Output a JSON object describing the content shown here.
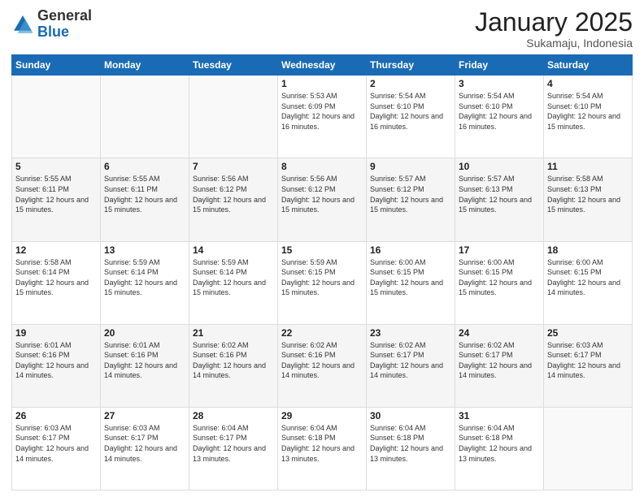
{
  "header": {
    "logo_general": "General",
    "logo_blue": "Blue",
    "month_title": "January 2025",
    "location": "Sukamaju, Indonesia"
  },
  "days_of_week": [
    "Sunday",
    "Monday",
    "Tuesday",
    "Wednesday",
    "Thursday",
    "Friday",
    "Saturday"
  ],
  "weeks": [
    [
      {
        "day": "",
        "info": ""
      },
      {
        "day": "",
        "info": ""
      },
      {
        "day": "",
        "info": ""
      },
      {
        "day": "1",
        "info": "Sunrise: 5:53 AM\nSunset: 6:09 PM\nDaylight: 12 hours and 16 minutes."
      },
      {
        "day": "2",
        "info": "Sunrise: 5:54 AM\nSunset: 6:10 PM\nDaylight: 12 hours and 16 minutes."
      },
      {
        "day": "3",
        "info": "Sunrise: 5:54 AM\nSunset: 6:10 PM\nDaylight: 12 hours and 16 minutes."
      },
      {
        "day": "4",
        "info": "Sunrise: 5:54 AM\nSunset: 6:10 PM\nDaylight: 12 hours and 15 minutes."
      }
    ],
    [
      {
        "day": "5",
        "info": "Sunrise: 5:55 AM\nSunset: 6:11 PM\nDaylight: 12 hours and 15 minutes."
      },
      {
        "day": "6",
        "info": "Sunrise: 5:55 AM\nSunset: 6:11 PM\nDaylight: 12 hours and 15 minutes."
      },
      {
        "day": "7",
        "info": "Sunrise: 5:56 AM\nSunset: 6:12 PM\nDaylight: 12 hours and 15 minutes."
      },
      {
        "day": "8",
        "info": "Sunrise: 5:56 AM\nSunset: 6:12 PM\nDaylight: 12 hours and 15 minutes."
      },
      {
        "day": "9",
        "info": "Sunrise: 5:57 AM\nSunset: 6:12 PM\nDaylight: 12 hours and 15 minutes."
      },
      {
        "day": "10",
        "info": "Sunrise: 5:57 AM\nSunset: 6:13 PM\nDaylight: 12 hours and 15 minutes."
      },
      {
        "day": "11",
        "info": "Sunrise: 5:58 AM\nSunset: 6:13 PM\nDaylight: 12 hours and 15 minutes."
      }
    ],
    [
      {
        "day": "12",
        "info": "Sunrise: 5:58 AM\nSunset: 6:14 PM\nDaylight: 12 hours and 15 minutes."
      },
      {
        "day": "13",
        "info": "Sunrise: 5:59 AM\nSunset: 6:14 PM\nDaylight: 12 hours and 15 minutes."
      },
      {
        "day": "14",
        "info": "Sunrise: 5:59 AM\nSunset: 6:14 PM\nDaylight: 12 hours and 15 minutes."
      },
      {
        "day": "15",
        "info": "Sunrise: 5:59 AM\nSunset: 6:15 PM\nDaylight: 12 hours and 15 minutes."
      },
      {
        "day": "16",
        "info": "Sunrise: 6:00 AM\nSunset: 6:15 PM\nDaylight: 12 hours and 15 minutes."
      },
      {
        "day": "17",
        "info": "Sunrise: 6:00 AM\nSunset: 6:15 PM\nDaylight: 12 hours and 15 minutes."
      },
      {
        "day": "18",
        "info": "Sunrise: 6:00 AM\nSunset: 6:15 PM\nDaylight: 12 hours and 14 minutes."
      }
    ],
    [
      {
        "day": "19",
        "info": "Sunrise: 6:01 AM\nSunset: 6:16 PM\nDaylight: 12 hours and 14 minutes."
      },
      {
        "day": "20",
        "info": "Sunrise: 6:01 AM\nSunset: 6:16 PM\nDaylight: 12 hours and 14 minutes."
      },
      {
        "day": "21",
        "info": "Sunrise: 6:02 AM\nSunset: 6:16 PM\nDaylight: 12 hours and 14 minutes."
      },
      {
        "day": "22",
        "info": "Sunrise: 6:02 AM\nSunset: 6:16 PM\nDaylight: 12 hours and 14 minutes."
      },
      {
        "day": "23",
        "info": "Sunrise: 6:02 AM\nSunset: 6:17 PM\nDaylight: 12 hours and 14 minutes."
      },
      {
        "day": "24",
        "info": "Sunrise: 6:02 AM\nSunset: 6:17 PM\nDaylight: 12 hours and 14 minutes."
      },
      {
        "day": "25",
        "info": "Sunrise: 6:03 AM\nSunset: 6:17 PM\nDaylight: 12 hours and 14 minutes."
      }
    ],
    [
      {
        "day": "26",
        "info": "Sunrise: 6:03 AM\nSunset: 6:17 PM\nDaylight: 12 hours and 14 minutes."
      },
      {
        "day": "27",
        "info": "Sunrise: 6:03 AM\nSunset: 6:17 PM\nDaylight: 12 hours and 14 minutes."
      },
      {
        "day": "28",
        "info": "Sunrise: 6:04 AM\nSunset: 6:17 PM\nDaylight: 12 hours and 13 minutes."
      },
      {
        "day": "29",
        "info": "Sunrise: 6:04 AM\nSunset: 6:18 PM\nDaylight: 12 hours and 13 minutes."
      },
      {
        "day": "30",
        "info": "Sunrise: 6:04 AM\nSunset: 6:18 PM\nDaylight: 12 hours and 13 minutes."
      },
      {
        "day": "31",
        "info": "Sunrise: 6:04 AM\nSunset: 6:18 PM\nDaylight: 12 hours and 13 minutes."
      },
      {
        "day": "",
        "info": ""
      }
    ]
  ]
}
